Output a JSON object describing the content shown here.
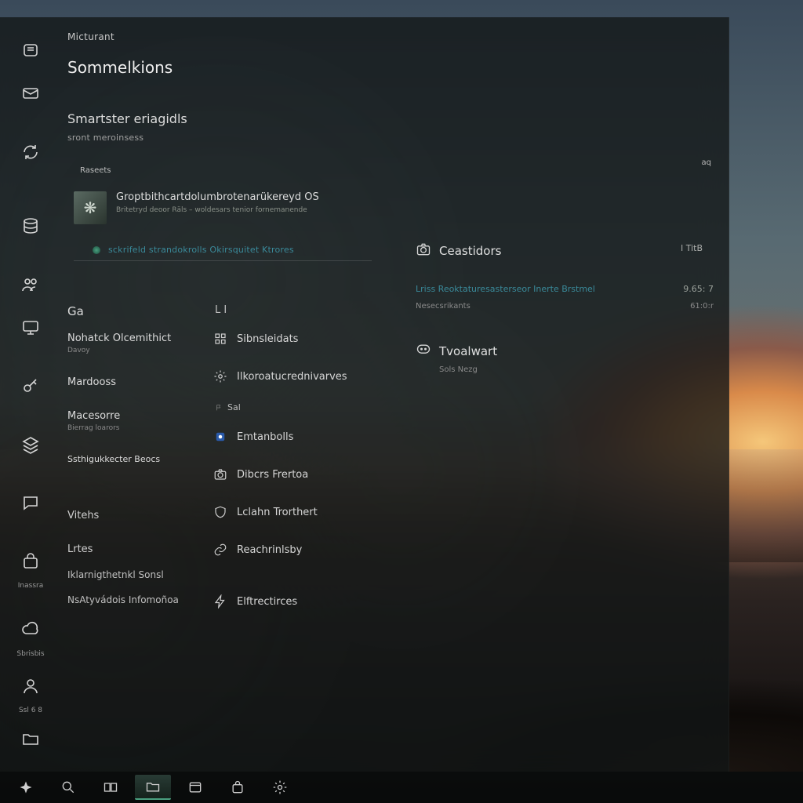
{
  "header": {
    "brand": "Micturant",
    "title": "Sommelkions",
    "section": "Smartster eriagidls",
    "subsection": "sront meroinsess",
    "badge": "Raseets",
    "topright_label": "aq"
  },
  "featured": {
    "title": "Groptbithcartdolumbrotenarükereyd OS",
    "subtitle": "Britetryd deoor Räls – woldesars tenior fornemanende"
  },
  "link": {
    "text": "sckrifeld strandokrolls Okirsquitet Ktrores"
  },
  "ga": {
    "title": "Ga",
    "items": [
      {
        "name": "Nohatck Olcemithict",
        "sub": "Davoy"
      },
      {
        "name": "Mardooss",
        "sub": ""
      },
      {
        "name": "Macesorre",
        "sub": "Bierrag loarors"
      },
      {
        "name": "Ssthigukkecter Beocs",
        "sub": ""
      }
    ],
    "section2": "Vitehs",
    "section3": "Lrtes",
    "row2a": "Iklarnigthetnkl Sonsl",
    "row2b": "NsAtyvádois Infomoñoa"
  },
  "li": {
    "title": "L I",
    "items": [
      "Sibnsleidats",
      "Ilkoroatucrednivarves",
      "Sal",
      "Emtanbolls",
      "Dibcrs Frertoa",
      "Lclahn Trorthert",
      "Reachrinlsby",
      "Elftrectirces"
    ]
  },
  "right": {
    "section1": {
      "title": "Ceastidors",
      "meta": "l TitB",
      "link": "Lriss Reoktaturesasterseor Inerte Brstmel",
      "link_meta": "9.65: 7",
      "sub": "Nesecsrikants",
      "sub_meta": "61:0:r"
    },
    "section2": {
      "title": "Tvoalwart",
      "sub": "Sols Nezg"
    }
  },
  "rail": {
    "labels": {
      "store": "Inassra",
      "docs": "Sbrisbis",
      "user": "Ssl 6 8"
    }
  },
  "taskbar": {
    "items": [
      "start",
      "search",
      "task-view",
      "explorer",
      "store",
      "mail",
      "settings"
    ]
  }
}
